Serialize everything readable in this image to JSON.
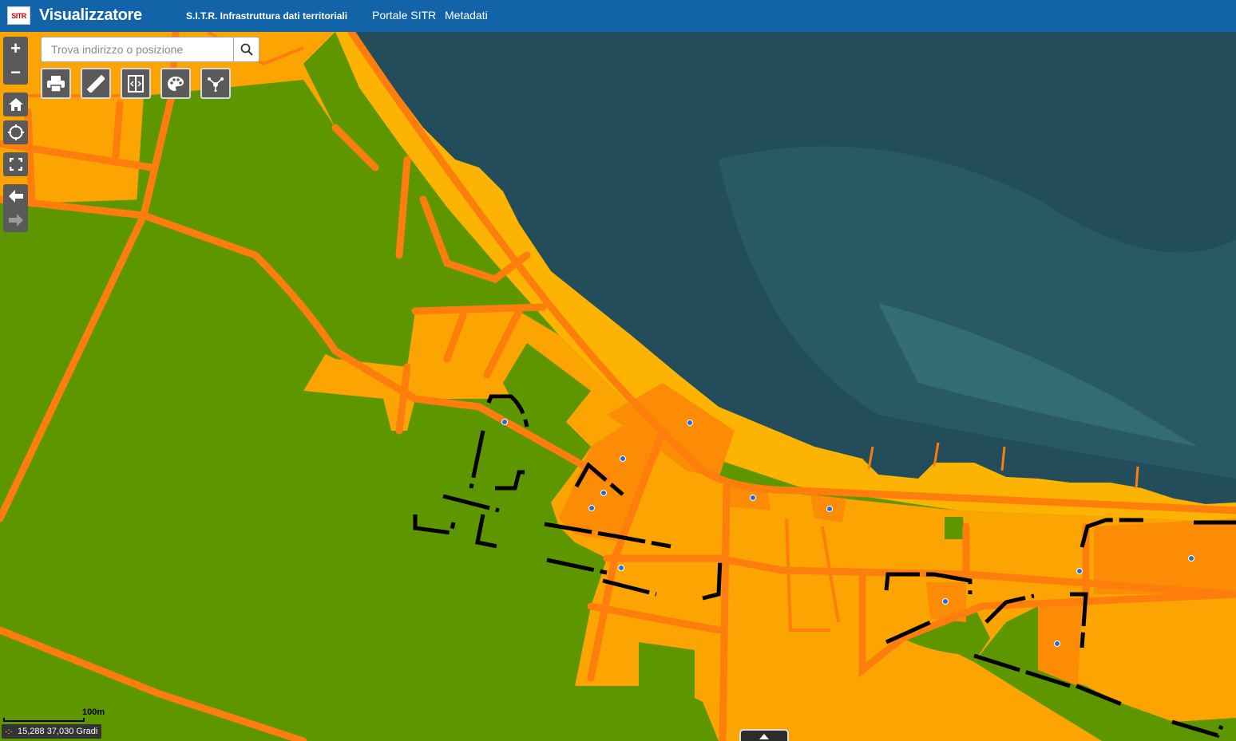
{
  "header": {
    "logo_text": "SITR",
    "title": "Visualizzatore",
    "subtitle": "S.I.T.R. Infrastruttura dati territoriali",
    "links": [
      "Portale SITR",
      "Metadati"
    ]
  },
  "search": {
    "placeholder": "Trova indirizzo o posizione"
  },
  "controls": {
    "zoom_in": "+",
    "zoom_out": "−"
  },
  "toolbar": {
    "tools": [
      "print-icon",
      "measure-icon",
      "swipe-icon",
      "palette-icon",
      "share-icon"
    ]
  },
  "scale": {
    "label": "100m"
  },
  "coordinates": {
    "text": "15,288 37,030 Gradi"
  },
  "colors": {
    "header": "#1363a8",
    "agricultural": "#5e9600",
    "urban_light": "#fba402",
    "urban_dark": "#fc8b05",
    "road": "#fd7e0d",
    "beach": "#fdb301",
    "sea": "#244d5b",
    "boundary": "#000000"
  }
}
